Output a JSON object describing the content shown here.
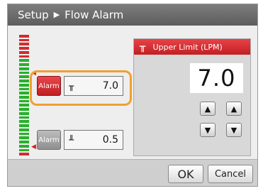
{
  "titlebar": {
    "section": "Setup",
    "page": "Flow Alarm"
  },
  "upper_alarm": {
    "button_label": "Alarm",
    "value": "7.0",
    "enabled": true
  },
  "lower_alarm": {
    "button_label": "Alarm",
    "value": "0.5",
    "enabled": false
  },
  "limit_panel": {
    "title": "Upper Limit (LPM)",
    "value": "7.0"
  },
  "actions": {
    "ok_label": "OK",
    "cancel_label": "Cancel"
  },
  "colors": {
    "alarm_red": "#d42a2e",
    "meter_green": "#28b02c",
    "highlight": "#f0a030"
  }
}
